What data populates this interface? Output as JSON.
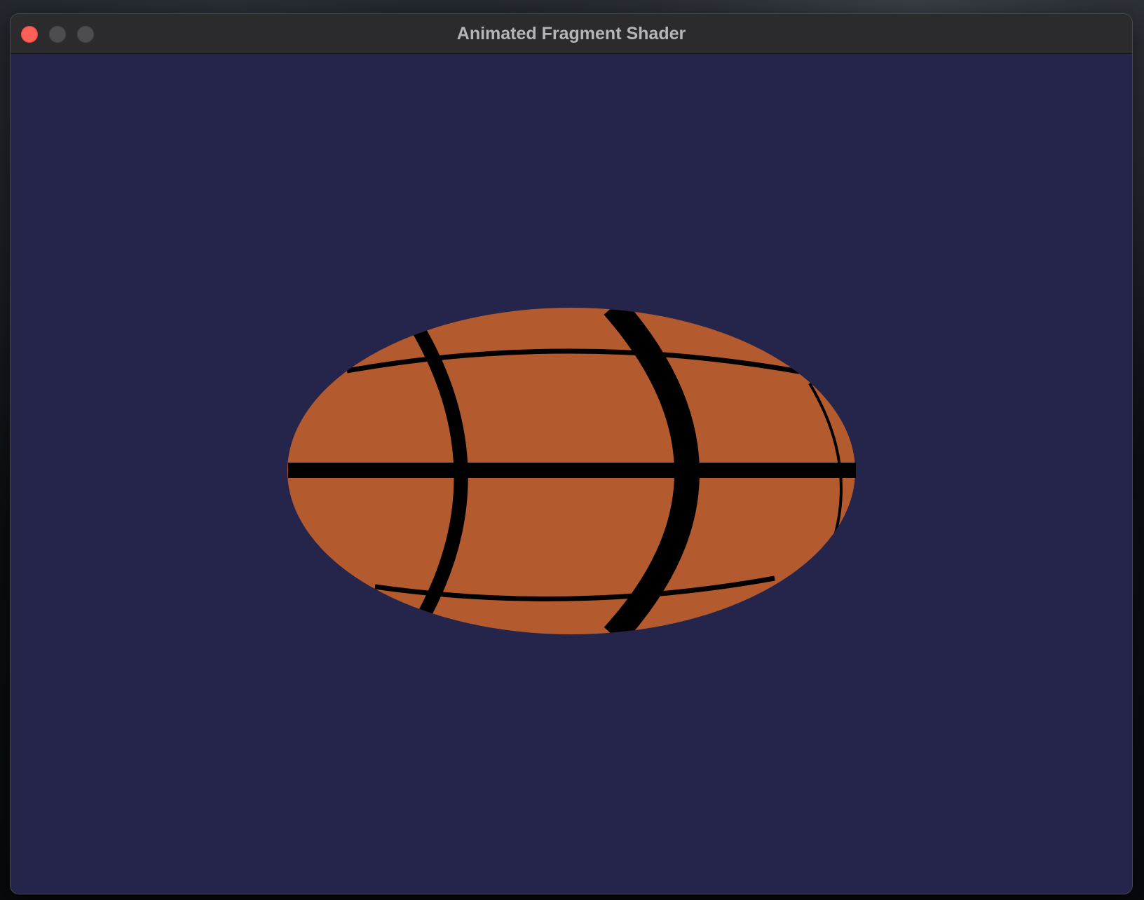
{
  "window": {
    "title": "Animated Fragment Shader",
    "controls": [
      {
        "name": "close",
        "color": "#fe5f57"
      },
      {
        "name": "minimize",
        "color": "#4d4d50"
      },
      {
        "name": "zoom",
        "color": "#4d4d50"
      }
    ]
  },
  "canvas": {
    "background_color": "#25244a",
    "ball_color": "#b35a2e",
    "seam_color": "#000000",
    "content": "shader-rendered-ball"
  }
}
